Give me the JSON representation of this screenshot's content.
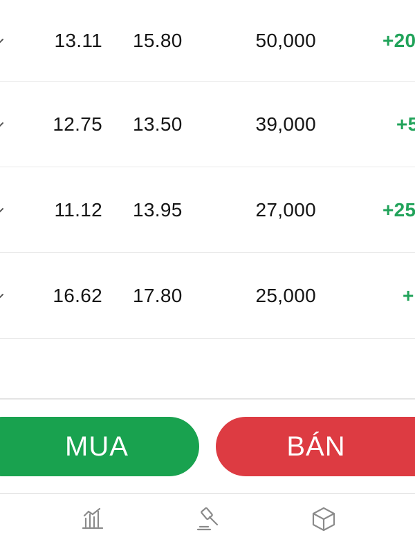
{
  "rows": [
    {
      "col1": "13.11",
      "col2": "15.80",
      "col3": "50,000",
      "col4": "+20"
    },
    {
      "col1": "12.75",
      "col2": "13.50",
      "col3": "39,000",
      "col4": "+5"
    },
    {
      "col1": "11.12",
      "col2": "13.95",
      "col3": "27,000",
      "col4": "+25"
    },
    {
      "col1": "16.62",
      "col2": "17.80",
      "col3": "25,000",
      "col4": "+"
    }
  ],
  "actions": {
    "buy_label": "MUA",
    "sell_label": "BÁN"
  },
  "colors": {
    "buy": "#19a24f",
    "sell": "#dd3b42",
    "positive": "#21a35a"
  },
  "tabbar": {
    "items": [
      {
        "icon": "market-chart-icon"
      },
      {
        "icon": "auction-gavel-icon"
      },
      {
        "icon": "box-icon"
      }
    ]
  }
}
